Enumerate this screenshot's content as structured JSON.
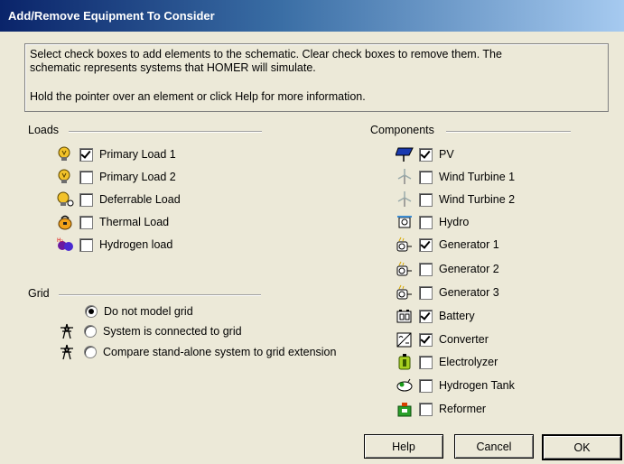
{
  "window": {
    "title": "Add/Remove Equipment To Consider"
  },
  "info": {
    "line1": "Select check boxes to add elements to the schematic. Clear check boxes to remove them. The",
    "line2": "schematic represents systems that HOMER will simulate.",
    "line3": "Hold the pointer over an element or click Help for more information."
  },
  "loads": {
    "heading": "Loads",
    "items": [
      {
        "label": "Primary Load 1",
        "checked": true,
        "icon": "lightbulb-icon"
      },
      {
        "label": "Primary Load 2",
        "checked": false,
        "icon": "lightbulb-icon"
      },
      {
        "label": "Deferrable Load",
        "checked": false,
        "icon": "lightbulb-deferrable-icon"
      },
      {
        "label": "Thermal Load",
        "checked": false,
        "icon": "kettle-icon"
      },
      {
        "label": "Hydrogen load",
        "checked": false,
        "icon": "hydrogen-molecule-icon"
      }
    ]
  },
  "grid": {
    "heading": "Grid",
    "options": [
      {
        "label": "Do not model grid",
        "selected": true,
        "icon": ""
      },
      {
        "label": "System is connected to grid",
        "selected": false,
        "icon": "power-tower-icon"
      },
      {
        "label": "Compare stand-alone system to grid extension",
        "selected": false,
        "icon": "power-tower-icon"
      }
    ]
  },
  "components": {
    "heading": "Components",
    "items": [
      {
        "label": "PV",
        "checked": true,
        "icon": "solar-panel-icon"
      },
      {
        "label": "Wind Turbine 1",
        "checked": false,
        "icon": "wind-turbine-icon"
      },
      {
        "label": "Wind Turbine 2",
        "checked": false,
        "icon": "wind-turbine-icon"
      },
      {
        "label": "Hydro",
        "checked": false,
        "icon": "hydro-turbine-icon"
      },
      {
        "label": "Generator 1",
        "checked": true,
        "icon": "generator-icon"
      },
      {
        "label": "Generator 2",
        "checked": false,
        "icon": "generator-icon"
      },
      {
        "label": "Generator 3",
        "checked": false,
        "icon": "generator-icon"
      },
      {
        "label": "Battery",
        "checked": true,
        "icon": "battery-icon"
      },
      {
        "label": "Converter",
        "checked": true,
        "icon": "converter-icon"
      },
      {
        "label": "Electrolyzer",
        "checked": false,
        "icon": "electrolyzer-icon"
      },
      {
        "label": "Hydrogen Tank",
        "checked": false,
        "icon": "hydrogen-tank-icon"
      },
      {
        "label": "Reformer",
        "checked": false,
        "icon": "reformer-icon"
      }
    ]
  },
  "buttons": {
    "help": "Help",
    "cancel": "Cancel",
    "ok": "OK"
  },
  "colors": {
    "title_start": "#0a246a",
    "title_end": "#a6caf0",
    "face": "#ece9d8"
  }
}
